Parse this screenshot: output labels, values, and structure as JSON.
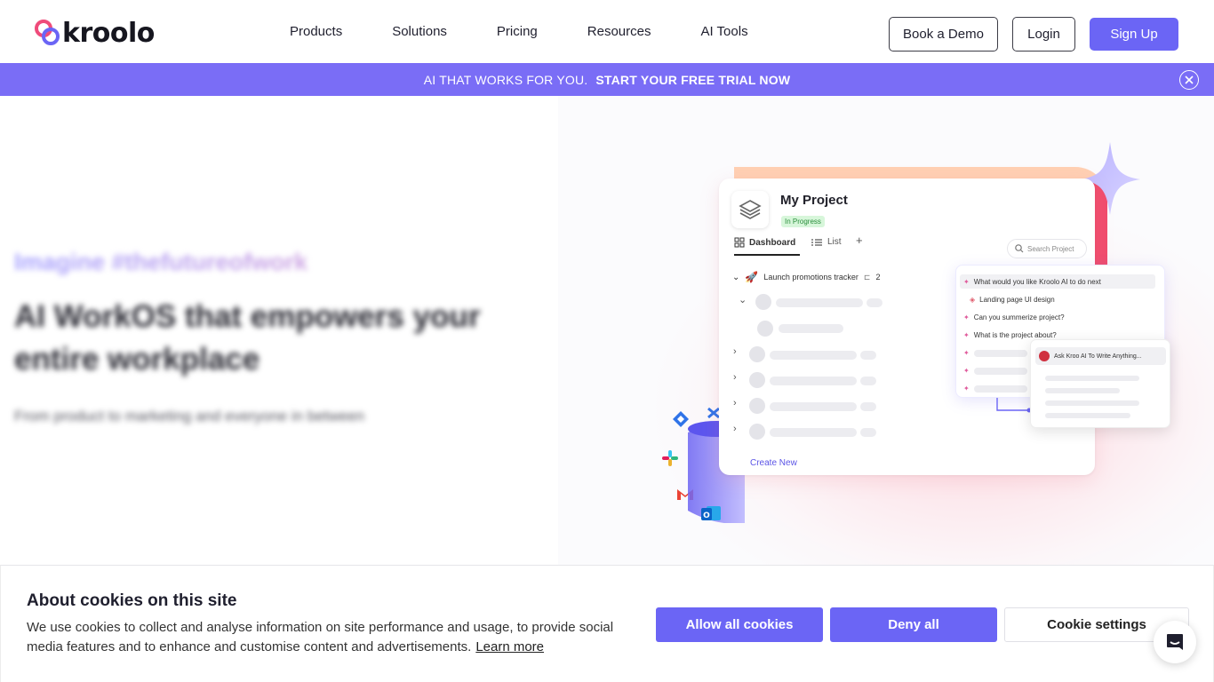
{
  "brand": {
    "name": "kroolo",
    "accent": "#6b65f5",
    "banner_color": "#7a6df6"
  },
  "nav": {
    "items": [
      "Products",
      "Solutions",
      "Pricing",
      "Resources",
      "AI Tools"
    ]
  },
  "header_actions": {
    "demo": "Book a Demo",
    "login": "Login",
    "signup": "Sign Up"
  },
  "banner": {
    "text": "AI THAT WORKS FOR YOU.",
    "cta": "START YOUR FREE TRIAL NOW",
    "close_icon": "close-circle-icon"
  },
  "hero": {
    "tagline": "Imagine #thefutureofwork",
    "title": "AI WorkOS that empowers your entire workplace",
    "subtitle": "From product to marketing and everyone in between"
  },
  "project": {
    "title": "My Project",
    "status": "In Progress",
    "tabs": [
      "Dashboard",
      "List",
      "+"
    ],
    "search_placeholder": "Search Project",
    "task": "Launch promotions tracker",
    "task_count": "2",
    "create_new": "Create New"
  },
  "ai_panel": {
    "prompt": "What would you like Kroolo AI to do next",
    "items": [
      "Landing page UI design",
      "Can you summerize project?",
      "What is the project about?"
    ],
    "popup_input": "Ask Kroo AI To Write Anything..."
  },
  "cookie": {
    "title": "About cookies on this site",
    "text": "We use cookies to collect and analyse information on site performance and usage, to provide social media features and to enhance and customise content and advertisements.",
    "learn_more": "Learn more",
    "allow": "Allow all cookies",
    "deny": "Deny all",
    "settings": "Cookie settings"
  }
}
